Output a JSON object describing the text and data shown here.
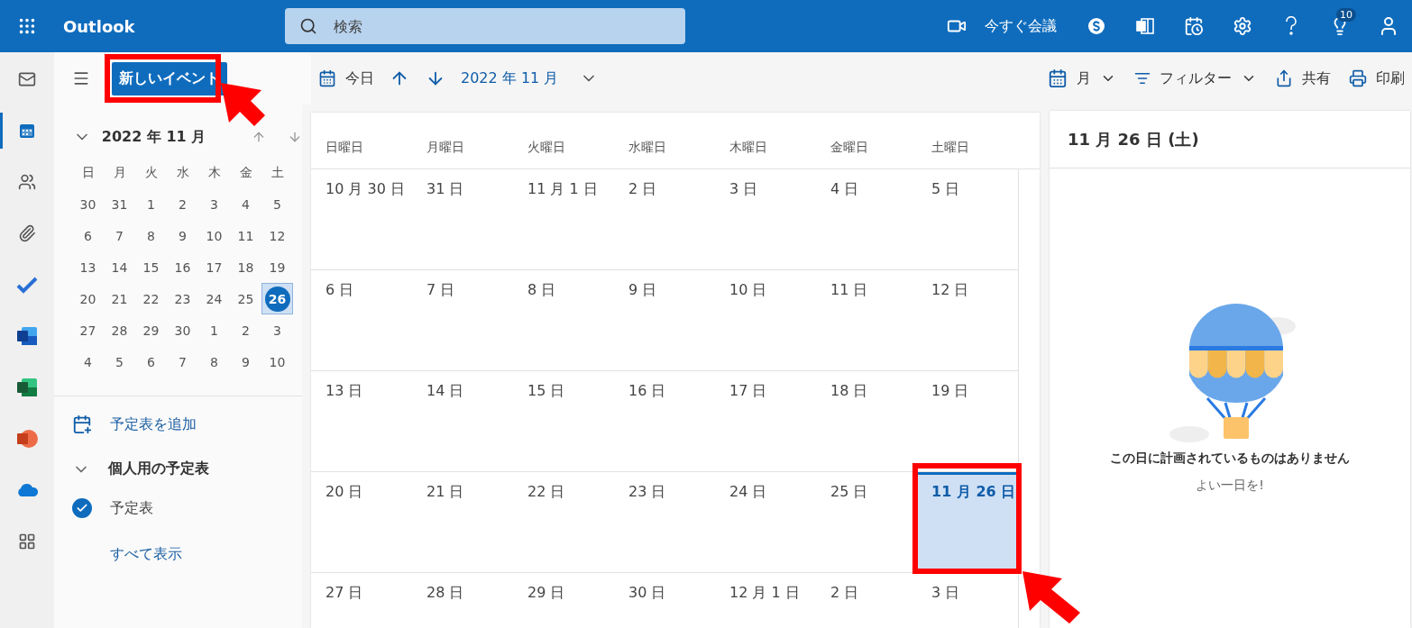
{
  "top_bar": {
    "app_title": "Outlook",
    "search": {
      "placeholder": "検索"
    },
    "meet_now": "今すぐ会議",
    "tips_count": "10"
  },
  "rail": [
    {
      "kind": "mail",
      "selected": false
    },
    {
      "kind": "calendar",
      "selected": true
    },
    {
      "kind": "people",
      "selected": false
    },
    {
      "kind": "files",
      "selected": false
    },
    {
      "kind": "todo",
      "selected": false
    },
    {
      "kind": "word",
      "selected": false
    },
    {
      "kind": "excel",
      "selected": false
    },
    {
      "kind": "powerpoint",
      "selected": false
    },
    {
      "kind": "onedrive",
      "selected": false
    },
    {
      "kind": "apps",
      "selected": false
    }
  ],
  "toolbar": {
    "new_event": "新しいイベント",
    "today": "今日",
    "period": "2022 年 11 月",
    "view": "月",
    "filter": "フィルター",
    "share": "共有",
    "print": "印刷"
  },
  "mini_calendar": {
    "title": "2022 年 11 月",
    "weekdays": [
      "日",
      "月",
      "火",
      "水",
      "木",
      "金",
      "土"
    ],
    "weeks": [
      [
        {
          "label": "30",
          "selected": false
        },
        {
          "label": "31",
          "selected": false
        },
        {
          "label": "1",
          "selected": false
        },
        {
          "label": "2",
          "selected": false
        },
        {
          "label": "3",
          "selected": false
        },
        {
          "label": "4",
          "selected": false
        },
        {
          "label": "5",
          "selected": false
        }
      ],
      [
        {
          "label": "6",
          "selected": false
        },
        {
          "label": "7",
          "selected": false
        },
        {
          "label": "8",
          "selected": false
        },
        {
          "label": "9",
          "selected": false
        },
        {
          "label": "10",
          "selected": false
        },
        {
          "label": "11",
          "selected": false
        },
        {
          "label": "12",
          "selected": false
        }
      ],
      [
        {
          "label": "13",
          "selected": false
        },
        {
          "label": "14",
          "selected": false
        },
        {
          "label": "15",
          "selected": false
        },
        {
          "label": "16",
          "selected": false
        },
        {
          "label": "17",
          "selected": false
        },
        {
          "label": "18",
          "selected": false
        },
        {
          "label": "19",
          "selected": false
        }
      ],
      [
        {
          "label": "20",
          "selected": false
        },
        {
          "label": "21",
          "selected": false
        },
        {
          "label": "22",
          "selected": false
        },
        {
          "label": "23",
          "selected": false
        },
        {
          "label": "24",
          "selected": false
        },
        {
          "label": "25",
          "selected": false
        },
        {
          "label": "26",
          "selected": true
        }
      ],
      [
        {
          "label": "27",
          "selected": false
        },
        {
          "label": "28",
          "selected": false
        },
        {
          "label": "29",
          "selected": false
        },
        {
          "label": "30",
          "selected": false
        },
        {
          "label": "1",
          "selected": false
        },
        {
          "label": "2",
          "selected": false
        },
        {
          "label": "3",
          "selected": false
        }
      ],
      [
        {
          "label": "4",
          "selected": false
        },
        {
          "label": "5",
          "selected": false
        },
        {
          "label": "6",
          "selected": false
        },
        {
          "label": "7",
          "selected": false
        },
        {
          "label": "8",
          "selected": false
        },
        {
          "label": "9",
          "selected": false
        },
        {
          "label": "10",
          "selected": false
        }
      ]
    ]
  },
  "add_calendar": "予定表を追加",
  "calendar_group": {
    "title": "個人用の予定表",
    "expanded": true,
    "calendars": [
      {
        "name": "予定表",
        "checked": true
      }
    ]
  },
  "show_all": "すべて表示",
  "month_grid": {
    "weekdays": [
      "日曜日",
      "月曜日",
      "火曜日",
      "水曜日",
      "木曜日",
      "金曜日",
      "土曜日"
    ],
    "weeks": [
      [
        {
          "label": "10 月 30 日",
          "selected": false
        },
        {
          "label": "31 日",
          "selected": false
        },
        {
          "label": "11 月 1 日",
          "selected": false
        },
        {
          "label": "2 日",
          "selected": false
        },
        {
          "label": "3 日",
          "selected": false
        },
        {
          "label": "4 日",
          "selected": false
        },
        {
          "label": "5 日",
          "selected": false
        }
      ],
      [
        {
          "label": "6 日",
          "selected": false
        },
        {
          "label": "7 日",
          "selected": false
        },
        {
          "label": "8 日",
          "selected": false
        },
        {
          "label": "9 日",
          "selected": false
        },
        {
          "label": "10 日",
          "selected": false
        },
        {
          "label": "11 日",
          "selected": false
        },
        {
          "label": "12 日",
          "selected": false
        }
      ],
      [
        {
          "label": "13 日",
          "selected": false
        },
        {
          "label": "14 日",
          "selected": false
        },
        {
          "label": "15 日",
          "selected": false
        },
        {
          "label": "16 日",
          "selected": false
        },
        {
          "label": "17 日",
          "selected": false
        },
        {
          "label": "18 日",
          "selected": false
        },
        {
          "label": "19 日",
          "selected": false
        }
      ],
      [
        {
          "label": "20 日",
          "selected": false
        },
        {
          "label": "21 日",
          "selected": false
        },
        {
          "label": "22 日",
          "selected": false
        },
        {
          "label": "23 日",
          "selected": false
        },
        {
          "label": "24 日",
          "selected": false
        },
        {
          "label": "25 日",
          "selected": false
        },
        {
          "label": "11 月 26 日",
          "selected": true
        }
      ],
      [
        {
          "label": "27 日",
          "selected": false
        },
        {
          "label": "28 日",
          "selected": false
        },
        {
          "label": "29 日",
          "selected": false
        },
        {
          "label": "30 日",
          "selected": false
        },
        {
          "label": "12 月 1 日",
          "selected": false
        },
        {
          "label": "2 日",
          "selected": false
        },
        {
          "label": "3 日",
          "selected": false
        }
      ]
    ]
  },
  "day_panel": {
    "title": "11 月 26 日 (土)",
    "empty_title": "この日に計画されているものはありません",
    "empty_subtitle": "よい一日を!"
  }
}
